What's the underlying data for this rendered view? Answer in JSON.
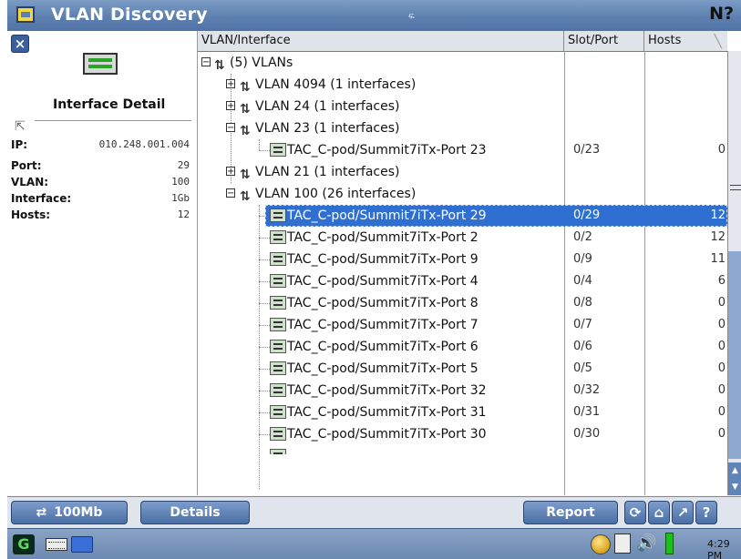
{
  "window": {
    "title": "VLAN Discovery",
    "mid_mark": "ፍ",
    "help_glyph": "N?"
  },
  "left_panel": {
    "close_label": "×",
    "detail_title": "Interface Detail",
    "details": [
      {
        "label": "IP:",
        "value": "010.248.001.004"
      },
      {
        "label": "Port:",
        "value": "29"
      },
      {
        "label": "VLAN:",
        "value": "100"
      },
      {
        "label": "Interface:",
        "value": "1Gb"
      },
      {
        "label": "Hosts:",
        "value": "12"
      }
    ]
  },
  "columns": {
    "vlan_interface": "VLAN/Interface",
    "slot_port": "Slot/Port",
    "hosts": "Hosts",
    "sort_mark": "╲"
  },
  "tree": {
    "root": "(5) VLANs",
    "vlans": [
      {
        "label": "VLAN 4094 (1 interfaces)",
        "expander": "+"
      },
      {
        "label": "VLAN 24 (1 interfaces)",
        "expander": "+"
      },
      {
        "label": "VLAN 23 (1 interfaces)",
        "expander": "−"
      },
      {
        "label": "VLAN 21 (1 interfaces)",
        "expander": "+"
      },
      {
        "label": "VLAN 100 (26 interfaces)",
        "expander": "−"
      }
    ],
    "vlan23_port": {
      "label": "TAC_C-pod/Summit7iTx-Port 23",
      "slot": "0/23",
      "hosts": "0"
    },
    "vlan100_ports": [
      {
        "label": "TAC_C-pod/Summit7iTx-Port 29",
        "slot": "0/29",
        "hosts": "12"
      },
      {
        "label": "TAC_C-pod/Summit7iTx-Port 2",
        "slot": "0/2",
        "hosts": "12"
      },
      {
        "label": "TAC_C-pod/Summit7iTx-Port 9",
        "slot": "0/9",
        "hosts": "11"
      },
      {
        "label": "TAC_C-pod/Summit7iTx-Port 4",
        "slot": "0/4",
        "hosts": "6"
      },
      {
        "label": "TAC_C-pod/Summit7iTx-Port 8",
        "slot": "0/8",
        "hosts": "0"
      },
      {
        "label": "TAC_C-pod/Summit7iTx-Port 7",
        "slot": "0/7",
        "hosts": "0"
      },
      {
        "label": "TAC_C-pod/Summit7iTx-Port 6",
        "slot": "0/6",
        "hosts": "0"
      },
      {
        "label": "TAC_C-pod/Summit7iTx-Port 5",
        "slot": "0/5",
        "hosts": "0"
      },
      {
        "label": "TAC_C-pod/Summit7iTx-Port 32",
        "slot": "0/32",
        "hosts": "0"
      },
      {
        "label": "TAC_C-pod/Summit7iTx-Port 31",
        "slot": "0/31",
        "hosts": "0"
      },
      {
        "label": "TAC_C-pod/Summit7iTx-Port 30",
        "slot": "0/30",
        "hosts": "0"
      }
    ],
    "vlan_icon": "⇅"
  },
  "buttons": {
    "speed": "100Mb",
    "details": "Details",
    "report": "Report",
    "icons": [
      "⟳",
      "⌂",
      "↗",
      "?"
    ]
  },
  "taskbar": {
    "start_label": "G",
    "clock": "4:29 PM"
  },
  "colors": {
    "accent": "#4a6fa5",
    "selection": "#2f6fd2",
    "titlebar": "#5d80b0"
  }
}
